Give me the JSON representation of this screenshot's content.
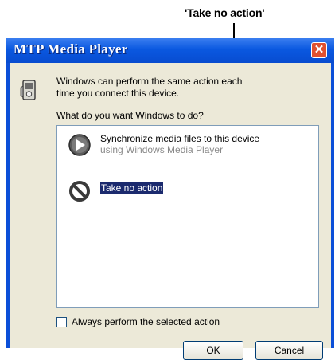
{
  "callout": {
    "label": "'Take no action'"
  },
  "dialog": {
    "title": "MTP Media Player",
    "close_label": "✕",
    "intro": "Windows can perform the same action each time you connect this device.",
    "question": "What do you want Windows to do?",
    "options": [
      {
        "title": "Synchronize media files to this device",
        "subtitle": "using Windows Media Player",
        "icon": "play-icon",
        "selected": false
      },
      {
        "title": "Take no action",
        "icon": "no-action-icon",
        "selected": true
      }
    ],
    "always_label": "Always perform the selected action",
    "always_checked": false,
    "ok_label": "OK",
    "cancel_label": "Cancel"
  },
  "colors": {
    "titlebar": "#0a58e0",
    "client": "#ece9d8",
    "selection": "#1b2a6e",
    "close": "#e0502f"
  }
}
